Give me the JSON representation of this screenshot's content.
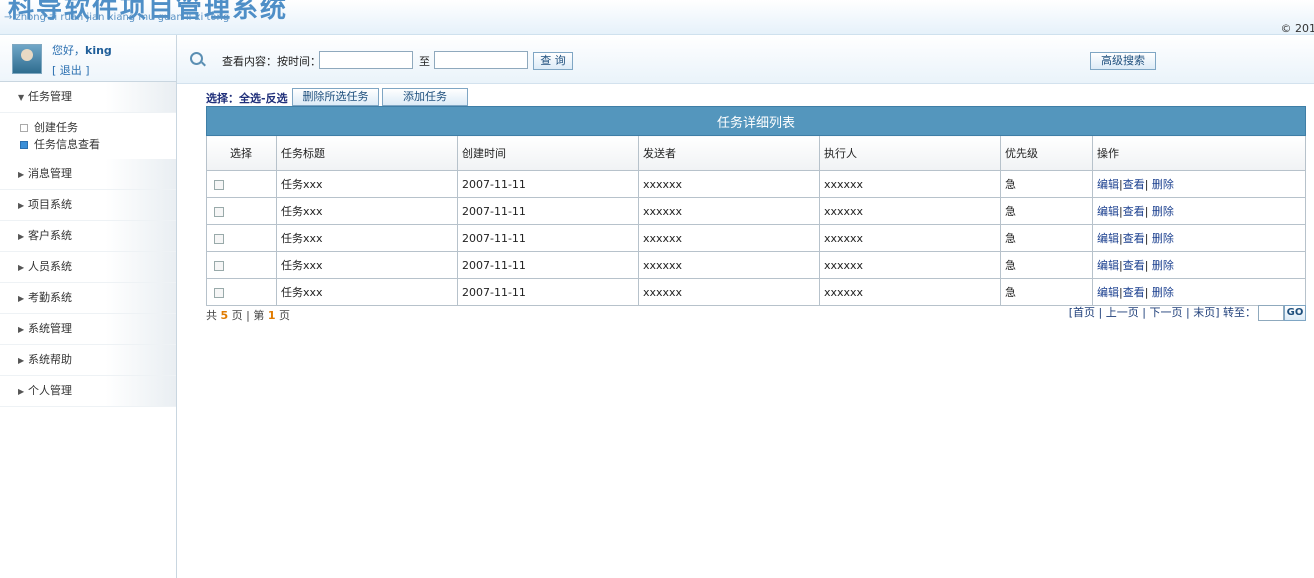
{
  "header": {
    "title": "科导软件项目管理系统",
    "subtitle": "→ zhong zi ruan jian xiang mu guan li xi tong",
    "copyright": "© 201"
  },
  "user": {
    "greeting": "您好，",
    "name": "king",
    "logout": "[ 退出 ]"
  },
  "sidebar": {
    "groups": [
      {
        "label": "任务管理",
        "expanded": true
      },
      {
        "label": "消息管理"
      },
      {
        "label": "项目系统"
      },
      {
        "label": "客户系统"
      },
      {
        "label": "人员系统"
      },
      {
        "label": "考勤系统"
      },
      {
        "label": "系统管理"
      },
      {
        "label": "系统帮助"
      },
      {
        "label": "个人管理"
      }
    ],
    "task_items": [
      {
        "label": "创建任务"
      },
      {
        "label": "任务信息查看",
        "active": true
      }
    ]
  },
  "search": {
    "label": "查看内容：按时间：",
    "to": "至",
    "query_button": "查 询",
    "advanced_button": "高级搜索",
    "start_value": "",
    "end_value": ""
  },
  "toolbar": {
    "select_label": "选择：全选-反选",
    "delete_button": "删除所选任务",
    "add_button": "添加任务"
  },
  "table": {
    "title": "任务详细列表",
    "columns": [
      "选择",
      "任务标题",
      "创建时间",
      "发送者",
      "执行人",
      "优先级",
      "操作"
    ],
    "rows": [
      {
        "title": "任务xxx",
        "created": "2007-11-11",
        "sender": "xxxxxx",
        "executor": "xxxxxx",
        "priority": "急"
      },
      {
        "title": "任务xxx",
        "created": "2007-11-11",
        "sender": "xxxxxx",
        "executor": "xxxxxx",
        "priority": "急"
      },
      {
        "title": "任务xxx",
        "created": "2007-11-11",
        "sender": "xxxxxx",
        "executor": "xxxxxx",
        "priority": "急"
      },
      {
        "title": "任务xxx",
        "created": "2007-11-11",
        "sender": "xxxxxx",
        "executor": "xxxxxx",
        "priority": "急"
      },
      {
        "title": "任务xxx",
        "created": "2007-11-11",
        "sender": "xxxxxx",
        "executor": "xxxxxx",
        "priority": "急"
      }
    ],
    "ops": {
      "edit": "编辑",
      "view": "查看",
      "delete": "删除"
    }
  },
  "pager": {
    "total_prefix": "共",
    "total_pages": "5",
    "page_unit": "页",
    "sep": "|",
    "current_prefix": "第",
    "current_page": "1",
    "first": "首页",
    "prev": "上一页",
    "next": "下一页",
    "last": "末页",
    "goto_label": "转至：",
    "go": "GO"
  },
  "colors": {
    "table_header_bg": "#5496bd",
    "link": "#1a3f8f",
    "accent": "#4f8fc7"
  }
}
